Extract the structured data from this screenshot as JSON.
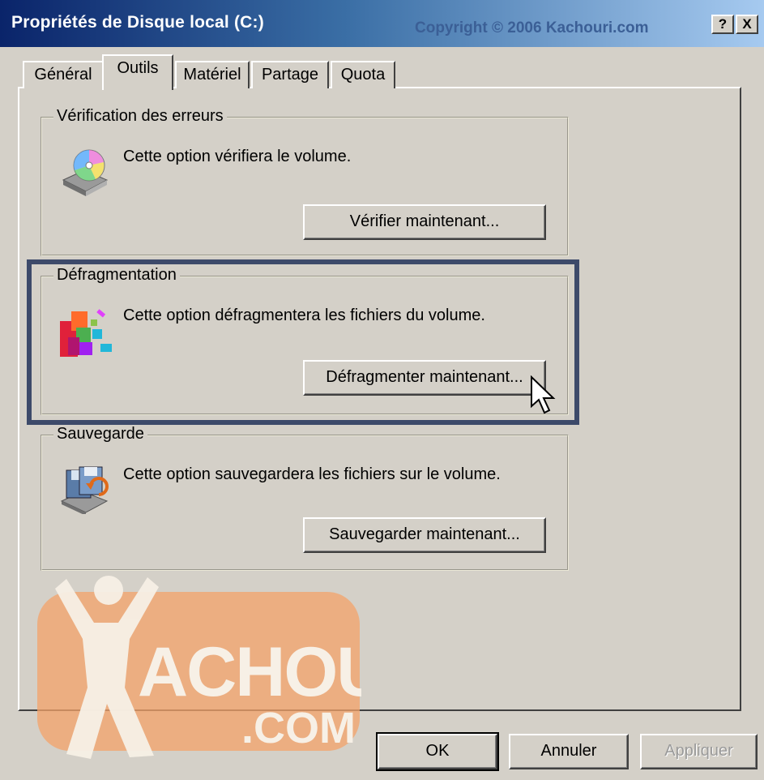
{
  "window": {
    "title": "Propriétés de Disque local (C:)",
    "copyright": "Copyright © 2006 Kachouri.com",
    "help_label": "?",
    "close_label": "X"
  },
  "tabs": [
    {
      "label": "Général"
    },
    {
      "label": "Outils",
      "active": true
    },
    {
      "label": "Matériel"
    },
    {
      "label": "Partage"
    },
    {
      "label": "Quota"
    }
  ],
  "groups": {
    "error_check": {
      "title": "Vérification des erreurs",
      "description": "Cette option vérifiera le volume.",
      "button": "Vérifier maintenant...",
      "icon": "disk-check-icon"
    },
    "defrag": {
      "title": "Défragmentation",
      "description": "Cette option défragmentera les fichiers du volume.",
      "button": "Défragmenter maintenant...",
      "icon": "defrag-icon"
    },
    "backup": {
      "title": "Sauvegarde",
      "description": "Cette option sauvegardera les fichiers sur le volume.",
      "button": "Sauvegarder maintenant...",
      "icon": "backup-icon"
    }
  },
  "footer": {
    "ok": "OK",
    "cancel": "Annuler",
    "apply": "Appliquer"
  },
  "watermark": {
    "brand": "ACHOURI",
    "suffix": ".COM",
    "color": "#f4a36a"
  },
  "colors": {
    "highlight_border": "#3d4a6a",
    "titlebar_start": "#0a246a",
    "dialog_bg": "#d4d0c8"
  }
}
